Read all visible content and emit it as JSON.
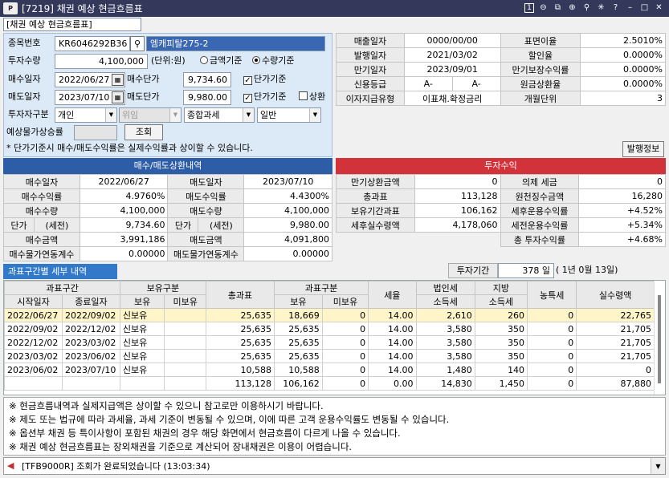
{
  "window": {
    "logo_text": "P",
    "title": "[7219] 채권 예상 현금흐름표",
    "page_number": "1"
  },
  "subtitle": "[채권 예상 현금흐름표]",
  "form": {
    "code_label": "종목번호",
    "code_value": "KR6046292B36",
    "bond_name": "엠캐피탈275-2",
    "qty_label": "투자수량",
    "qty_value": "4,100,000",
    "unit_label": "(단위:원)",
    "radio_amount": "금액기준",
    "radio_qty": "수량기준",
    "buy_date_label": "매수일자",
    "buy_date": "2022/06/27",
    "buy_price_label": "매수단가",
    "buy_price": "9,734.60",
    "sell_date_label": "매도일자",
    "sell_date": "2023/07/10",
    "sell_price_label": "매도단가",
    "sell_price": "9,980.00",
    "unit_basis_label": "단가기준",
    "unit_basis2_label": "단가기준",
    "redeem_label": "상환",
    "investor_label": "투자자구분",
    "investor_value": "개인",
    "agent_value": "위임",
    "tax_value": "종합과세",
    "normal_value": "일반",
    "price_var_label": "예상물가상승률",
    "query_button": "조회",
    "note": "* 단가기준시 매수/매도수익률은 실제수익률과 상이할 수 있습니다."
  },
  "bond_info": {
    "rows": [
      {
        "l1": "매출일자",
        "v1": "0000/00/00",
        "l2": "표면이율",
        "v2": "2.5010%"
      },
      {
        "l1": "발행일자",
        "v1": "2021/03/02",
        "l2": "할인율",
        "v2": "0.0000%"
      },
      {
        "l1": "만기일자",
        "v1": "2023/09/01",
        "l2": "만기보장수익률",
        "v2": "0.0000%"
      },
      {
        "l1": "신용등급",
        "v1a": "A-",
        "v1b": "A-",
        "l2": "원금상환율",
        "v2": "0.0000%"
      },
      {
        "l1": "이자지급유형",
        "v1": "이표채.확정금리",
        "l2": "개월단위",
        "v2": "3"
      }
    ],
    "issue_button": "발행정보"
  },
  "trade": {
    "header": "매수/매도상환내역",
    "rows": [
      {
        "l1": "매수일자",
        "v1": "2022/06/27",
        "l2": "매도일자",
        "v2": "2023/07/10"
      },
      {
        "l1": "매수수익률",
        "v1": "4.9760%",
        "l2": "매도수익률",
        "v2": "4.4300%"
      },
      {
        "l1": "매수수량",
        "v1": "4,100,000",
        "l2": "매도수량",
        "v2": "4,100,000"
      },
      {
        "l1a": "단가",
        "l1b": "(세전)",
        "v1": "9,734.60",
        "l2a": "단가",
        "l2b": "(세전)",
        "v2": "9,980.00"
      },
      {
        "l1": "매수금액",
        "v1": "3,991,186",
        "l2": "매도금액",
        "v2": "4,091,800"
      },
      {
        "l1": "매수물가연동계수",
        "v1": "0.00000",
        "l2": "매도물가연동계수",
        "v2": "0.00000"
      }
    ]
  },
  "returns": {
    "header": "투자수익",
    "rows": [
      {
        "l1": "만기상환금액",
        "v1": "0",
        "l2": "의제 세금",
        "v2": "0"
      },
      {
        "l1": "총과표",
        "v1": "113,128",
        "l2": "원천징수금액",
        "v2": "16,280"
      },
      {
        "l1": "보유기간과표",
        "v1": "106,162",
        "l2": "세후운용수익률",
        "v2": "+4.52%"
      },
      {
        "l1": "세후실수령액",
        "v1": "4,178,060",
        "l2": "세전운용수익률",
        "v2": "+5.34%"
      },
      {
        "l1": "",
        "v1": "",
        "l2": "총 투자수익률",
        "v2": "+4.68%"
      }
    ]
  },
  "detail": {
    "tab_label": "과표구간별 세부 내역",
    "period_label": "투자기간",
    "period_days": "378 일",
    "period_text": "( 1년  0월 13일)",
    "h_period": "과표구간",
    "h_hold": "보유구분",
    "h_taxbase": "총과표",
    "h_taxtype": "과표구분",
    "h_tax": "세율",
    "h_corp1": "법인세",
    "h_corp2": "소득세",
    "h_local1": "지방",
    "h_local2": "소득세",
    "h_farm": "농특세",
    "h_actual": "실수령액",
    "h_start": "시작일자",
    "h_end": "종료일자",
    "h_own": "보유",
    "h_notown": "미보유",
    "h_own2": "보유",
    "h_notown2": "미보유",
    "rows": [
      [
        "2022/06/27",
        "2022/09/02",
        "신보유",
        "",
        "25,635",
        "18,669",
        "0",
        "14.00",
        "2,610",
        "260",
        "0",
        "22,765"
      ],
      [
        "2022/09/02",
        "2022/12/02",
        "신보유",
        "",
        "25,635",
        "25,635",
        "0",
        "14.00",
        "3,580",
        "350",
        "0",
        "21,705"
      ],
      [
        "2022/12/02",
        "2023/03/02",
        "신보유",
        "",
        "25,635",
        "25,635",
        "0",
        "14.00",
        "3,580",
        "350",
        "0",
        "21,705"
      ],
      [
        "2023/03/02",
        "2023/06/02",
        "신보유",
        "",
        "25,635",
        "25,635",
        "0",
        "14.00",
        "3,580",
        "350",
        "0",
        "21,705"
      ],
      [
        "2023/06/02",
        "2023/07/10",
        "신보유",
        "",
        "10,588",
        "10,588",
        "0",
        "14.00",
        "1,480",
        "140",
        "0",
        "0"
      ]
    ],
    "total": [
      "",
      "",
      "",
      "",
      "113,128",
      "106,162",
      "0",
      "0.00",
      "14,830",
      "1,450",
      "0",
      "87,880"
    ]
  },
  "notes": [
    "※ 현금흐름내역과 실제지급액은 상이할 수 있으니 참고로만 이용하시기 바랍니다.",
    "※ 제도 또는 법규에 따라 과세율, 과세 기준이 변동될 수 있으며, 이에 따른 고객 운용수익률도 변동될 수 있습니다.",
    "※ 옵션부 채권 등 특이사항이 포함된 채권의 경우 해당 화면에서 현금흐름이 다르게 나올 수 있습니다.",
    "※ 채권 예상 현금흐름표는 장외채권을 기준으로 계산되어 장내채권은 이용이 어렵습니다."
  ],
  "status": "[TFB9000R] 조회가 완료되었습니다 (13:03:34)"
}
